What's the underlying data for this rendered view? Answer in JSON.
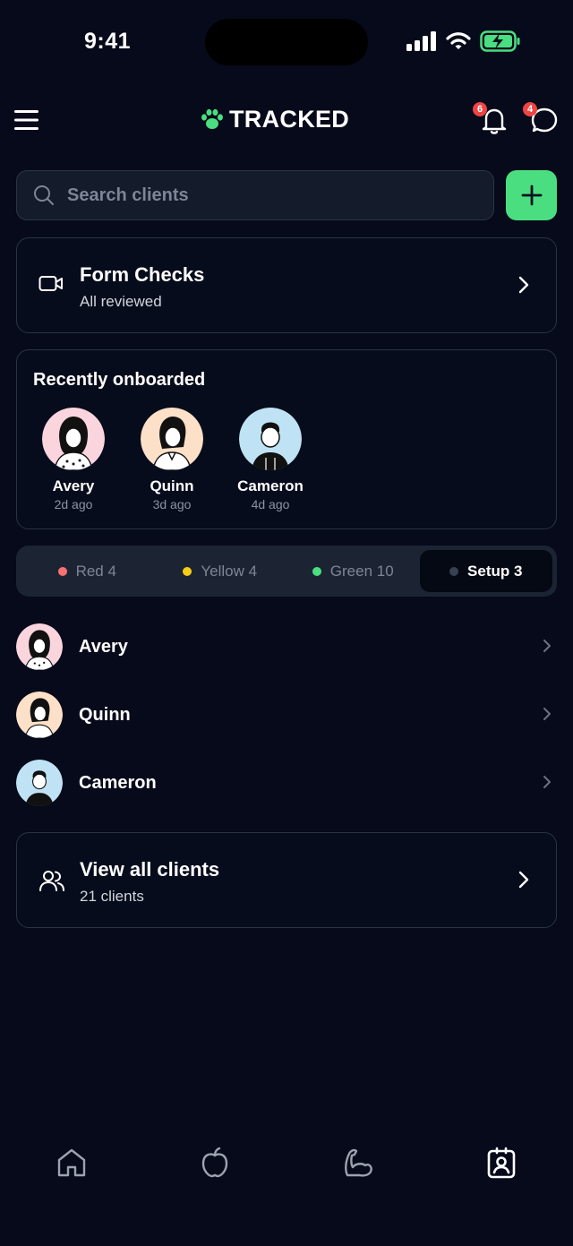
{
  "status_bar": {
    "time": "9:41"
  },
  "header": {
    "brand": "TRACKED",
    "notifications_count": "6",
    "messages_count": "4",
    "accent": "#4ade80"
  },
  "search": {
    "placeholder": "Search clients"
  },
  "form_checks": {
    "title": "Form Checks",
    "subtitle": "All reviewed"
  },
  "recent": {
    "title": "Recently onboarded",
    "items": [
      {
        "name": "Avery",
        "time": "2d ago",
        "avatar_bg": "#fbd5dd"
      },
      {
        "name": "Quinn",
        "time": "3d ago",
        "avatar_bg": "#fde0c8"
      },
      {
        "name": "Cameron",
        "time": "4d ago",
        "avatar_bg": "#bfe3f5"
      }
    ]
  },
  "filters": [
    {
      "label": "Red 4",
      "color": "#f87171",
      "active": false
    },
    {
      "label": "Yellow 4",
      "color": "#facc15",
      "active": false
    },
    {
      "label": "Green 10",
      "color": "#4ade80",
      "active": false
    },
    {
      "label": "Setup 3",
      "color": "#374151",
      "active": true
    }
  ],
  "clients": [
    {
      "name": "Avery"
    },
    {
      "name": "Quinn"
    },
    {
      "name": "Cameron"
    }
  ],
  "view_all": {
    "title": "View all clients",
    "subtitle": "21 clients"
  },
  "tabs": [
    {
      "icon": "home-icon"
    },
    {
      "icon": "apple-icon"
    },
    {
      "icon": "flexed-arm-icon"
    },
    {
      "icon": "client-badge-icon",
      "active": true
    }
  ]
}
